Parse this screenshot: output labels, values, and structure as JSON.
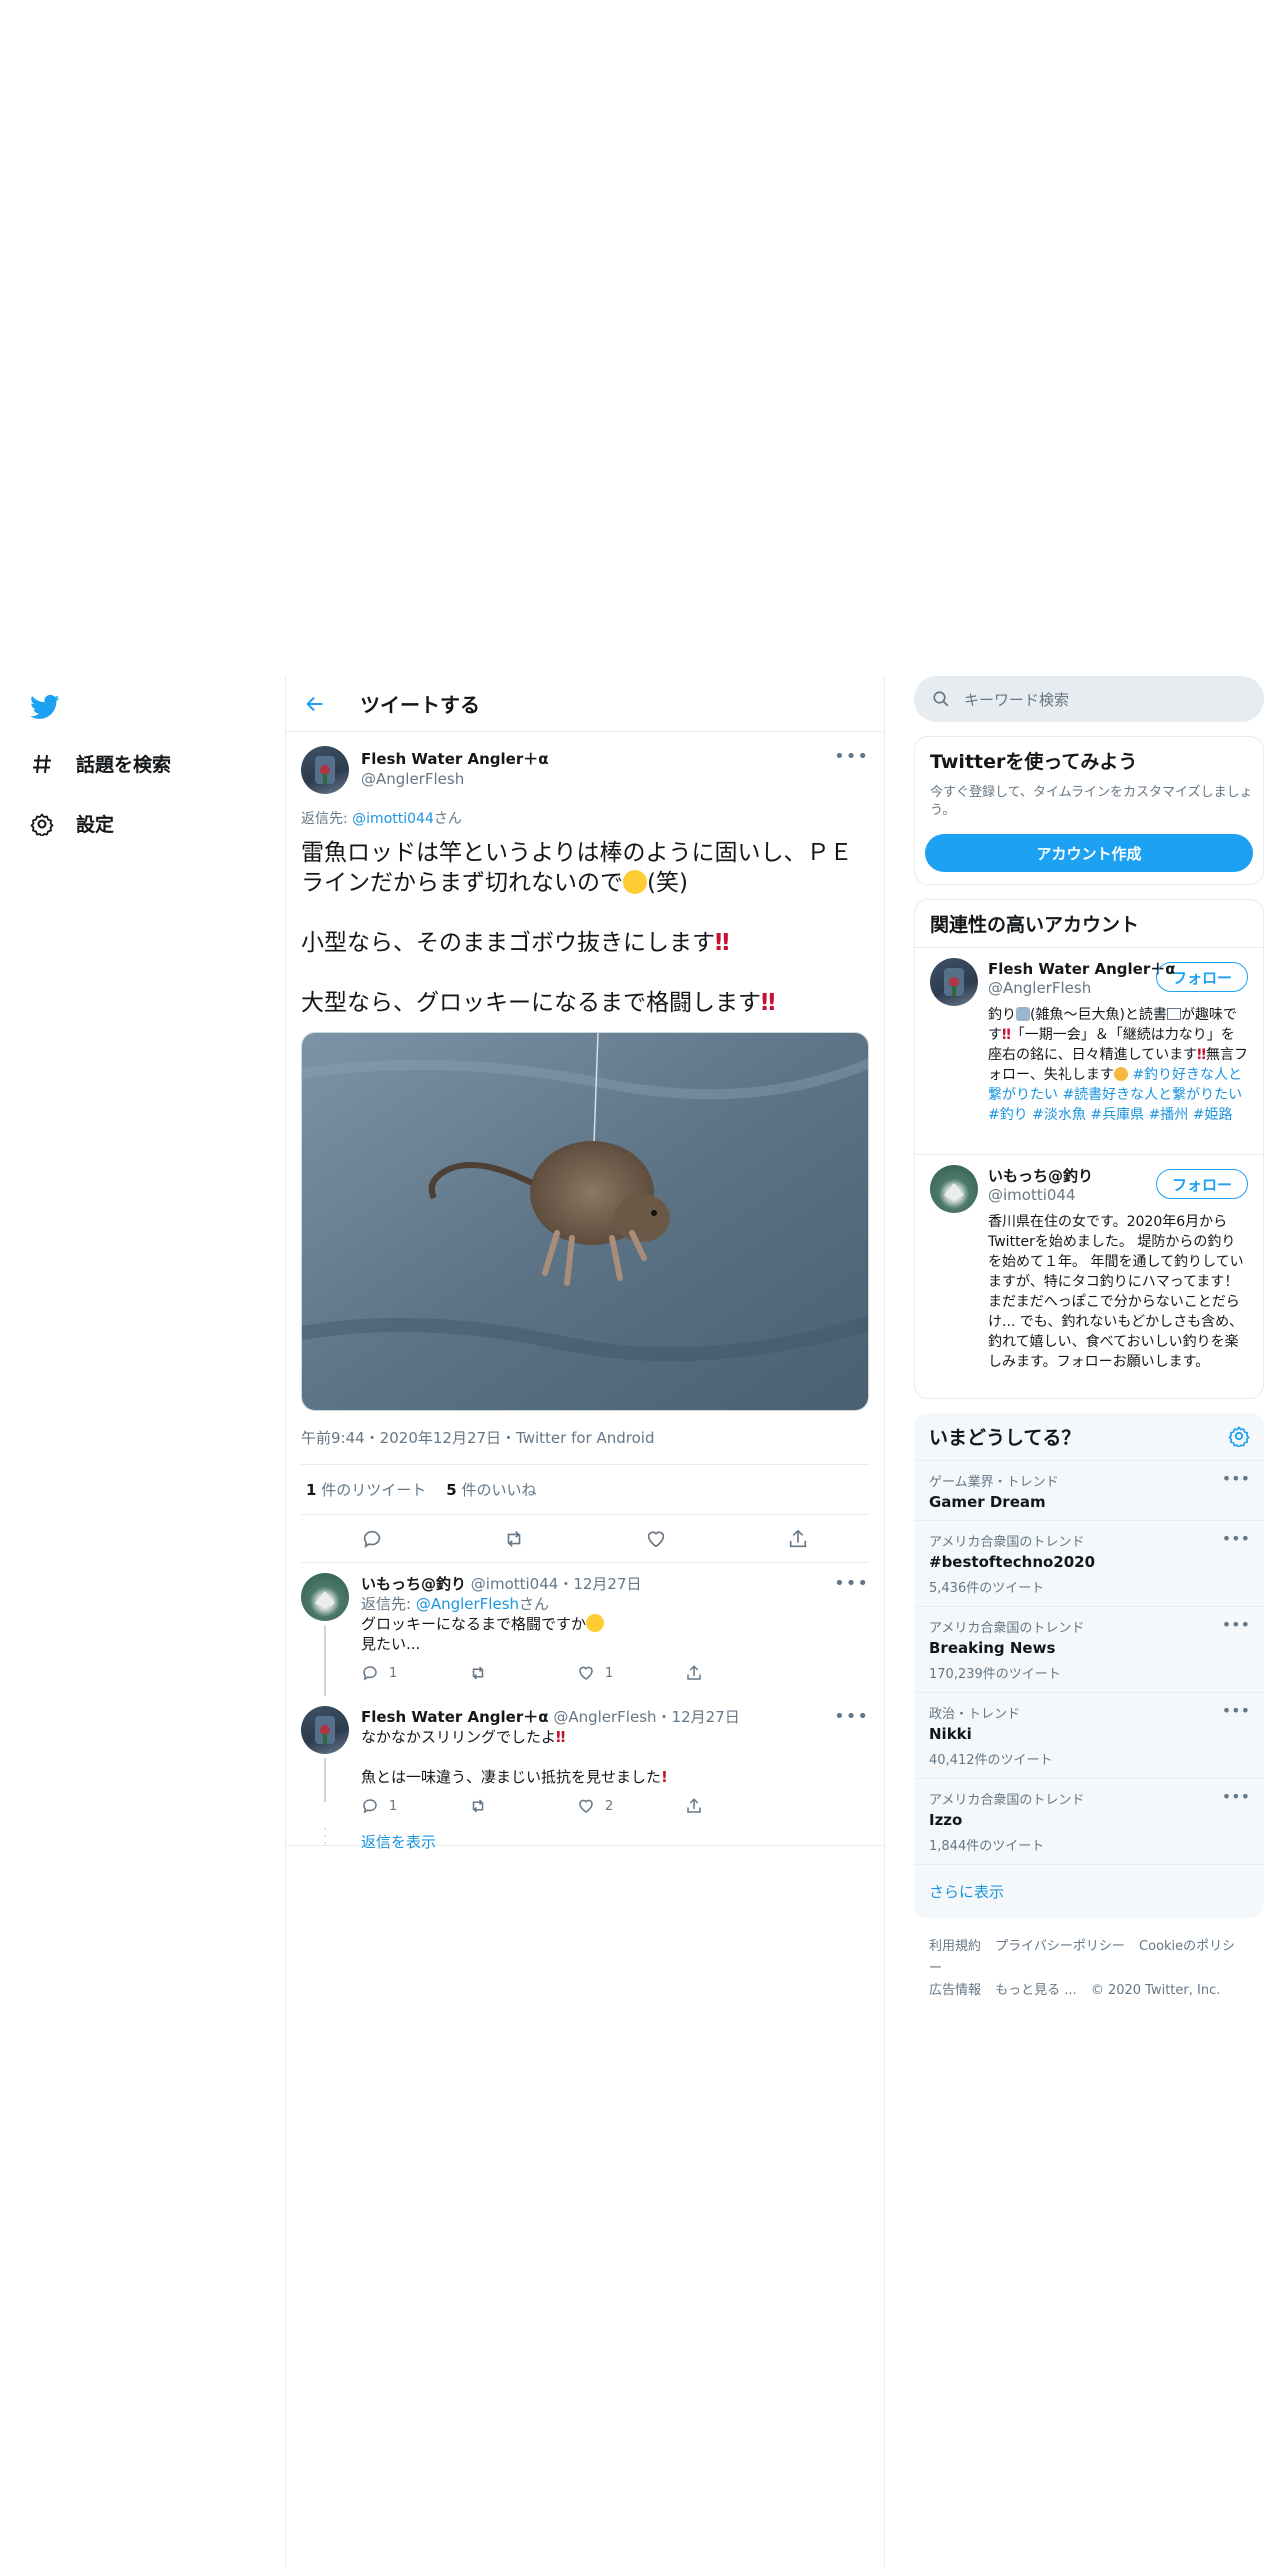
{
  "nav": {
    "logo": "twitter-bird-icon",
    "items": [
      {
        "label": "話題を検索",
        "icon": "hashtag-icon"
      },
      {
        "label": "設定",
        "icon": "gear-icon"
      }
    ]
  },
  "header": {
    "title": "ツイートする"
  },
  "tweet": {
    "author_name": "Flesh Water Angler＋α",
    "author_handle": "@AnglerFlesh",
    "reply_prefix": "返信先: ",
    "reply_to": "@imotti044",
    "reply_suffix": "さん",
    "line1a": "雷魚ロッドは竿というよりは棒のように固いし、ＰＥラインだからまず切れないので",
    "line1b": "(笑)",
    "line2": "小型なら、そのままゴボウ抜きにします",
    "line3": "大型なら、グロッキーになるまで格闘します",
    "bang": "‼",
    "meta": "午前9:44・2020年12月27日・Twitter for Android",
    "retweets": "1",
    "retweets_label": "件のリツイート",
    "likes": "5",
    "likes_label": "件のいいね"
  },
  "replies": [
    {
      "name": "いもっち@釣り",
      "handle": "@imotti044",
      "date": "12月27日",
      "reply_prefix": "返信先: ",
      "reply_to": "@AnglerFlesh",
      "reply_suffix": "さん",
      "text1": "グロッキーになるまで格闘ですか",
      "text2": "見たい...",
      "replies": "1",
      "likes": "1"
    },
    {
      "name": "Flesh Water Angler＋α",
      "handle": "@AnglerFlesh",
      "date": "12月27日",
      "text1": "なかなかスリリングでしたよ",
      "text2": "魚とは一味違う、凄まじい抵抗を見せました",
      "replies": "1",
      "likes": "2"
    }
  ],
  "show_replies": "返信を表示",
  "search": {
    "placeholder": "キーワード検索"
  },
  "signup": {
    "title": "Twitterを使ってみよう",
    "sub": "今すぐ登録して、タイムラインをカスタマイズしましょう。",
    "button": "アカウント作成"
  },
  "related": {
    "title": "関連性の高いアカウント",
    "follow": "フォロー",
    "accounts": [
      {
        "name": "Flesh Water Angler＋α",
        "handle": "@AnglerFlesh",
        "bio_a": "釣り",
        "bio_b": "(雑魚～巨大魚)と読書",
        "bio_c": "が趣味です",
        "bio_d": "「一期一会」＆「継続は力なり」を座右の銘に、日々精進しています",
        "bio_e": "無言フォロー、失礼します",
        "tags": "#釣り好きな人と繋がりたい #読書好きな人と繋がりたい #釣り #淡水魚 #兵庫県 #播州 #姫路"
      },
      {
        "name": "いもっち@釣り",
        "handle": "@imotti044",
        "bio": "香川県在住の女です。2020年6月からTwitterを始めました。 堤防からの釣りを始めて１年。 年間を通して釣りしていますが、特にタコ釣りにハマってます！ まだまだへっぽこで分からないことだらけ... でも、釣れないもどかしさも含め、釣れて嬉しい、食べておいしい釣りを楽しみます。フォローお願いします。"
      }
    ]
  },
  "trends": {
    "title": "いまどうしてる？",
    "items": [
      {
        "context": "ゲーム業界・トレンド",
        "name": "Gamer Dream",
        "count": ""
      },
      {
        "context": "アメリカ合衆国のトレンド",
        "name": "#bestoftechno2020",
        "count": "5,436件のツイート"
      },
      {
        "context": "アメリカ合衆国のトレンド",
        "name": "Breaking News",
        "count": "170,239件のツイート"
      },
      {
        "context": "政治・トレンド",
        "name": "Nikki",
        "count": "40,412件のツイート"
      },
      {
        "context": "アメリカ合衆国のトレンド",
        "name": "Izzo",
        "count": "1,844件のツイート"
      }
    ],
    "show_more": "さらに表示"
  },
  "footer": {
    "links1": [
      "利用規約",
      "プライバシーポリシー",
      "Cookieのポリシー"
    ],
    "links2": [
      "広告情報",
      "もっと見る ..."
    ],
    "copyright": "© 2020 Twitter, Inc."
  },
  "colors": {
    "accent": "#1da1f2",
    "link": "#1b95e0",
    "muted": "#657786",
    "border": "#e6ecf0"
  }
}
